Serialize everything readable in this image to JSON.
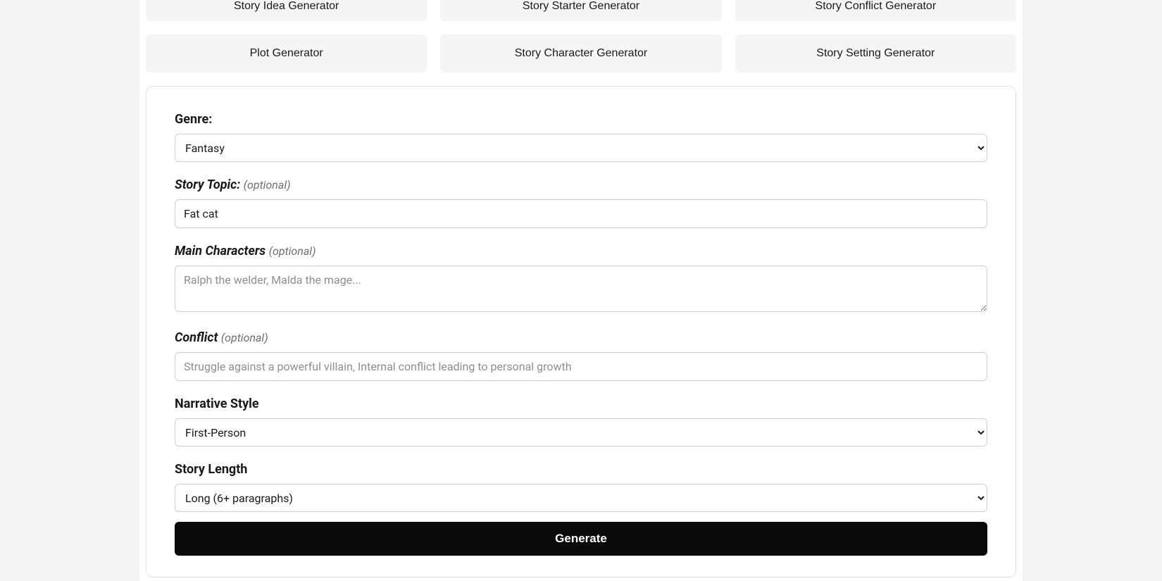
{
  "buttons": {
    "row1": [
      "Story Idea Generator",
      "Story Starter Generator",
      "Story Conflict Generator"
    ],
    "row2": [
      "Plot Generator",
      "Story Character Generator",
      "Story Setting Generator"
    ]
  },
  "form": {
    "genre": {
      "label": "Genre:",
      "value": "Fantasy"
    },
    "topic": {
      "label": "Story Topic:",
      "optional": "(optional)",
      "value": "Fat cat"
    },
    "characters": {
      "label": "Main Characters",
      "optional": "(optional)",
      "placeholder": "Ralph the welder, Malda the mage..."
    },
    "conflict": {
      "label": "Conflict",
      "optional": "(optional)",
      "placeholder": "Struggle against a powerful villain, Internal conflict leading to personal growth"
    },
    "narrative": {
      "label": "Narrative Style",
      "value": "First-Person"
    },
    "length": {
      "label": "Story Length",
      "value": "Long (6+ paragraphs)"
    },
    "generate": "Generate"
  }
}
